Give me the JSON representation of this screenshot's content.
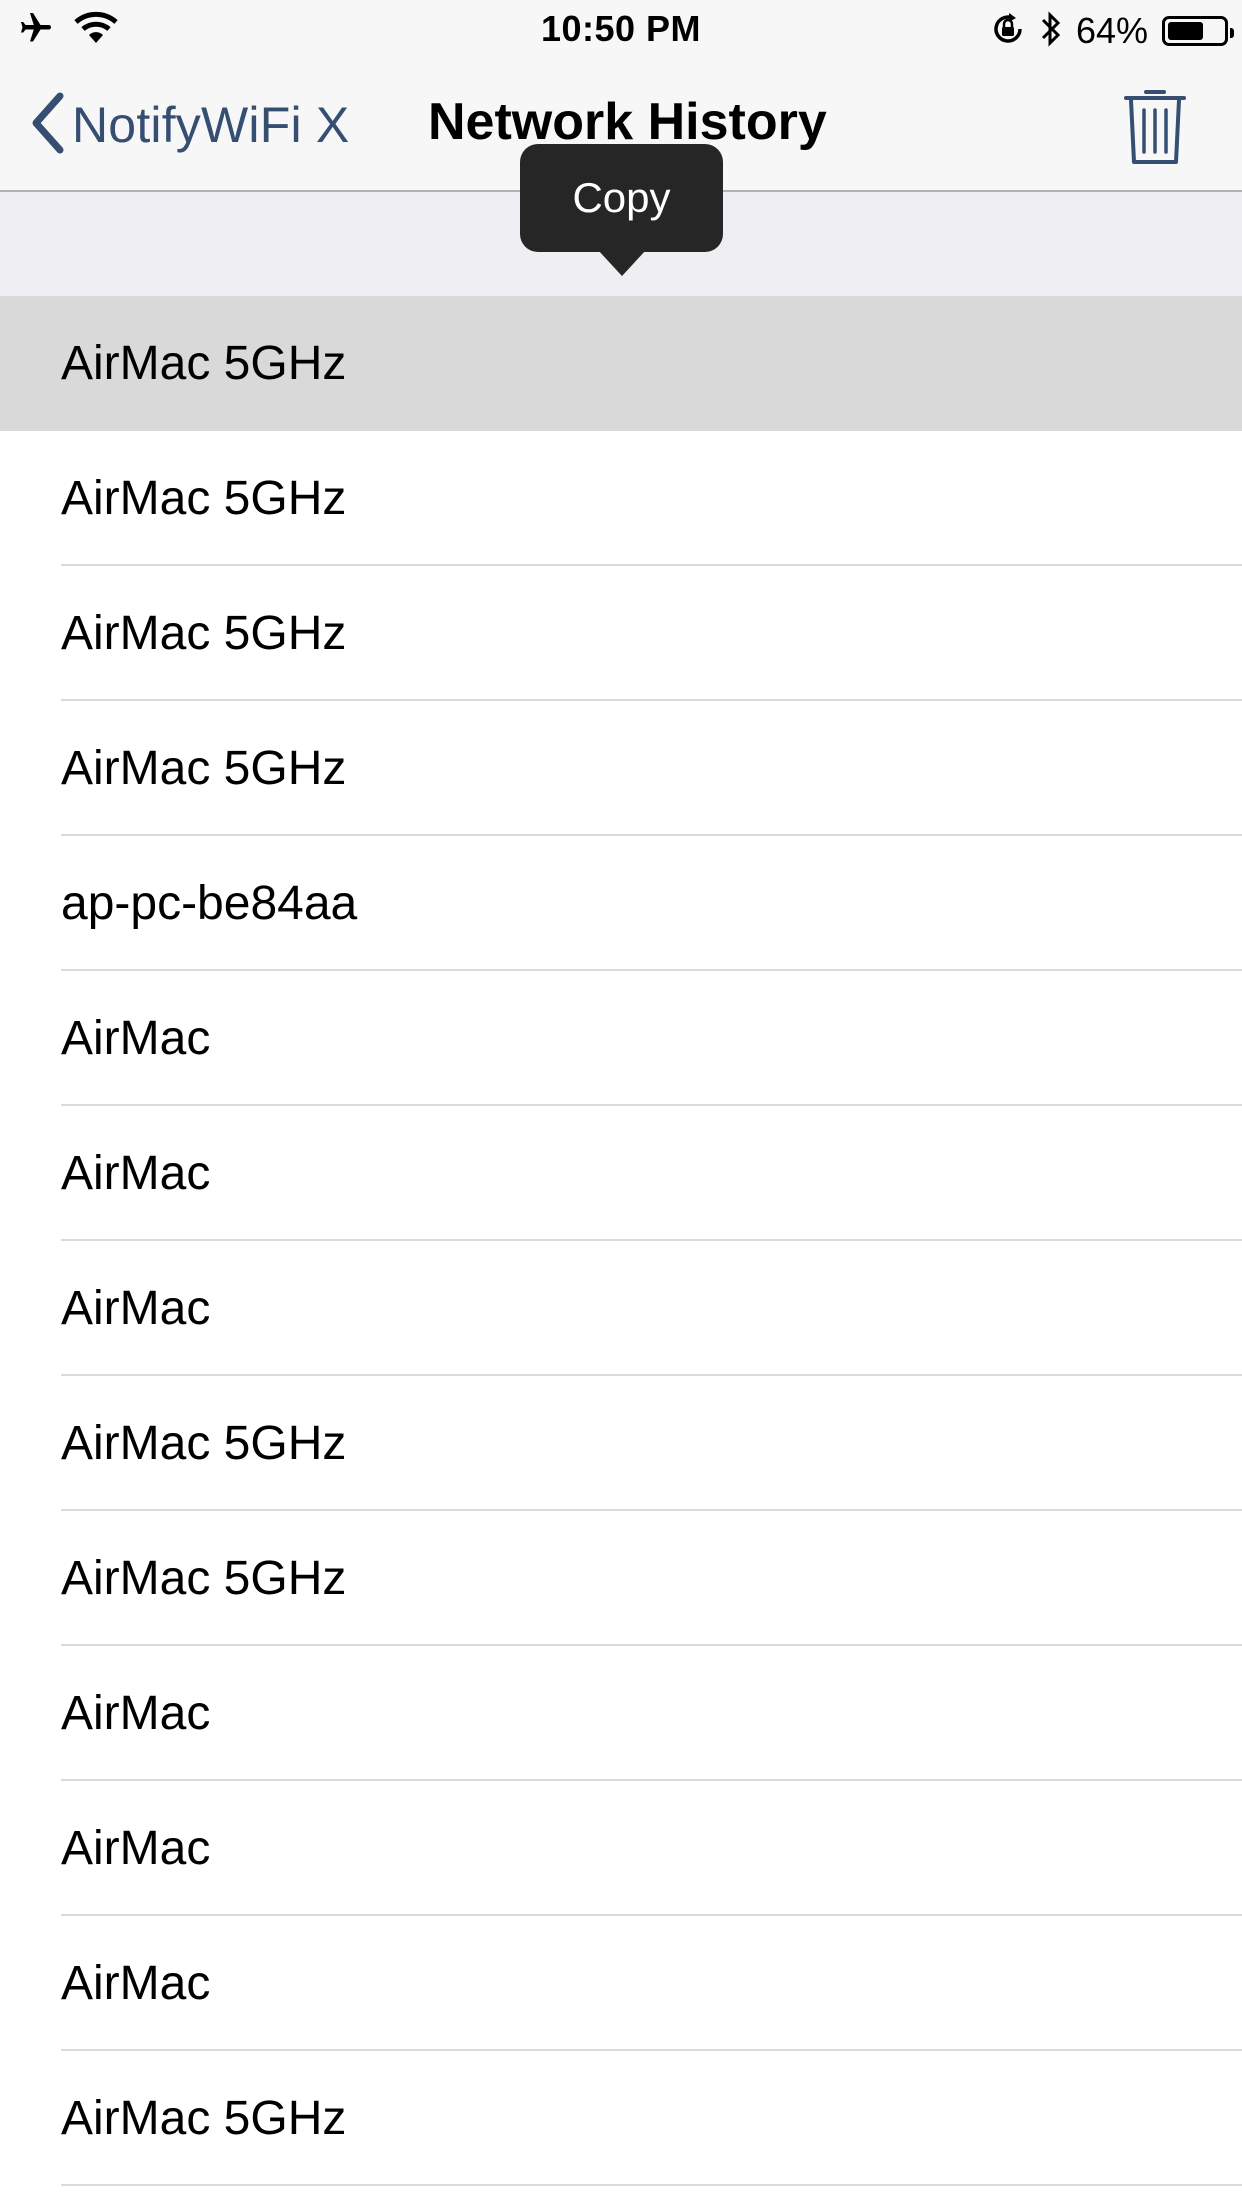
{
  "status_bar": {
    "time": "10:50 PM",
    "battery_percent": "64%",
    "battery_level": 0.64,
    "icons": [
      "airplane-icon",
      "wifi-icon",
      "orientation-lock-icon",
      "bluetooth-icon",
      "battery-icon"
    ]
  },
  "nav": {
    "back_label": "NotifyWiFi X",
    "title": "Network History",
    "trash_icon": "trash-icon"
  },
  "context_menu": {
    "copy_label": "Copy"
  },
  "history": {
    "items": [
      "AirMac 5GHz",
      "AirMac 5GHz",
      "AirMac 5GHz",
      "AirMac 5GHz",
      "ap-pc-be84aa",
      "AirMac",
      "AirMac",
      "AirMac",
      "AirMac 5GHz",
      "AirMac 5GHz",
      "AirMac",
      "AirMac",
      "AirMac",
      "AirMac 5GHz"
    ],
    "selected_index": 0
  },
  "colors": {
    "accent": "#354e72",
    "menu_background": "#262626",
    "selected_row": "#d9d9d9",
    "header_band": "#eeeef3"
  }
}
